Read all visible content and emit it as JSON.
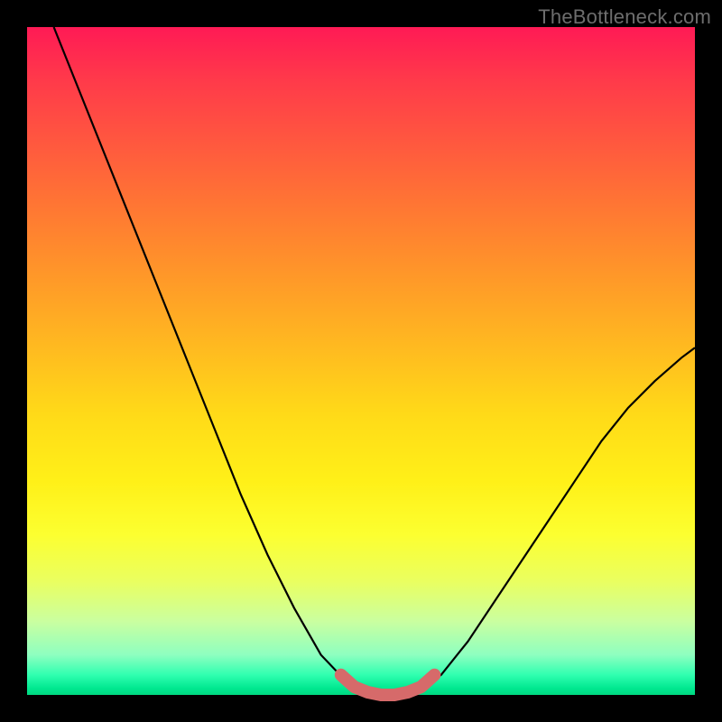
{
  "watermark": "TheBottleneck.com",
  "chart_data": {
    "type": "line",
    "title": "",
    "xlabel": "",
    "ylabel": "",
    "xlim": [
      0,
      1
    ],
    "ylim": [
      0,
      1
    ],
    "series": [
      {
        "name": "bottleneck-curve",
        "x": [
          0.04,
          0.08,
          0.12,
          0.16,
          0.2,
          0.24,
          0.28,
          0.32,
          0.36,
          0.4,
          0.44,
          0.48,
          0.5,
          0.52,
          0.545,
          0.57,
          0.59,
          0.62,
          0.66,
          0.7,
          0.74,
          0.78,
          0.82,
          0.86,
          0.9,
          0.94,
          0.98,
          1.0
        ],
        "y": [
          1.0,
          0.9,
          0.8,
          0.7,
          0.6,
          0.5,
          0.4,
          0.3,
          0.21,
          0.13,
          0.06,
          0.018,
          0.008,
          0.003,
          0.0,
          0.003,
          0.01,
          0.03,
          0.08,
          0.14,
          0.2,
          0.26,
          0.32,
          0.38,
          0.43,
          0.47,
          0.505,
          0.52
        ]
      },
      {
        "name": "optimal-range-marker",
        "x": [
          0.47,
          0.49,
          0.51,
          0.53,
          0.55,
          0.57,
          0.59,
          0.61
        ],
        "y": [
          0.03,
          0.012,
          0.004,
          0.0,
          0.0,
          0.004,
          0.012,
          0.03
        ]
      }
    ],
    "gradient_stops": [
      {
        "pos": 0.0,
        "color": "#ff1a55"
      },
      {
        "pos": 0.5,
        "color": "#ffda18"
      },
      {
        "pos": 0.85,
        "color": "#eaff60"
      },
      {
        "pos": 1.0,
        "color": "#00d880"
      }
    ]
  }
}
